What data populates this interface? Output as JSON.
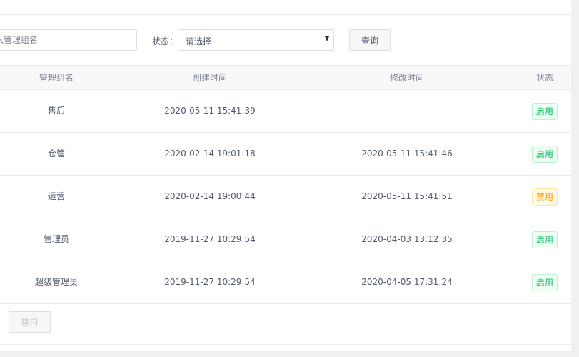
{
  "filters": {
    "name_placeholder": "入管理组名",
    "status_label": "状态：",
    "status_value": "请选择",
    "query_button": "查询"
  },
  "table": {
    "headers": {
      "name": "管理组名",
      "created": "创建时间",
      "modified": "修改时间",
      "status": "状态"
    },
    "rows": [
      {
        "name": "售后",
        "created": "2020-05-11 15:41:39",
        "modified": "-",
        "status": "启用",
        "status_type": "enabled"
      },
      {
        "name": "仓管",
        "created": "2020-02-14 19:01:18",
        "modified": "2020-05-11 15:41:46",
        "status": "启用",
        "status_type": "enabled"
      },
      {
        "name": "运营",
        "created": "2020-02-14 19:00:44",
        "modified": "2020-05-11 15:41:51",
        "status": "禁用",
        "status_type": "disabled"
      },
      {
        "name": "管理员",
        "created": "2019-11-27 10:29:54",
        "modified": "2020-04-03 13:12:35",
        "status": "启用",
        "status_type": "enabled"
      },
      {
        "name": "超级管理员",
        "created": "2019-11-27 10:29:54",
        "modified": "2020-04-05 17:31:24",
        "status": "启用",
        "status_type": "enabled"
      }
    ]
  },
  "footer": {
    "disable_button": "禁用"
  },
  "colors": {
    "enabled": "#19be6b",
    "disabled": "#ff9900",
    "header_bg": "#f8f8f9",
    "border": "#e8eaec"
  }
}
